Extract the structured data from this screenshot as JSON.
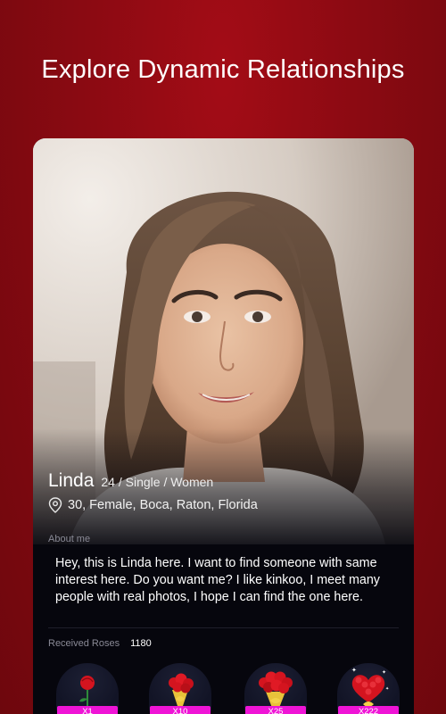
{
  "headline": "Explore Dynamic Relationships",
  "profile": {
    "name": "Linda",
    "meta": "24 / Single / Women",
    "location": "30, Female, Boca, Raton, Florida",
    "about_label": "About me",
    "about_text": "Hey, this is Linda here. I want to find someone with same interest here. Do you want me? I like kinkoo, I meet many people with real photos, I hope I can find the one here.",
    "roses_label": "Received Roses",
    "roses_count": "1180"
  },
  "gifts": [
    {
      "label": "X1",
      "icon": "single-rose-icon"
    },
    {
      "label": "X10",
      "icon": "rose-bouquet-icon"
    },
    {
      "label": "X25",
      "icon": "rose-bouquet-large-icon"
    },
    {
      "label": "X222",
      "icon": "rose-heart-bouquet-icon"
    }
  ],
  "colors": {
    "background": "#8a0a12",
    "card": "#06060d",
    "gift_tag": "#ef14d6",
    "rose": "#d4141f"
  }
}
